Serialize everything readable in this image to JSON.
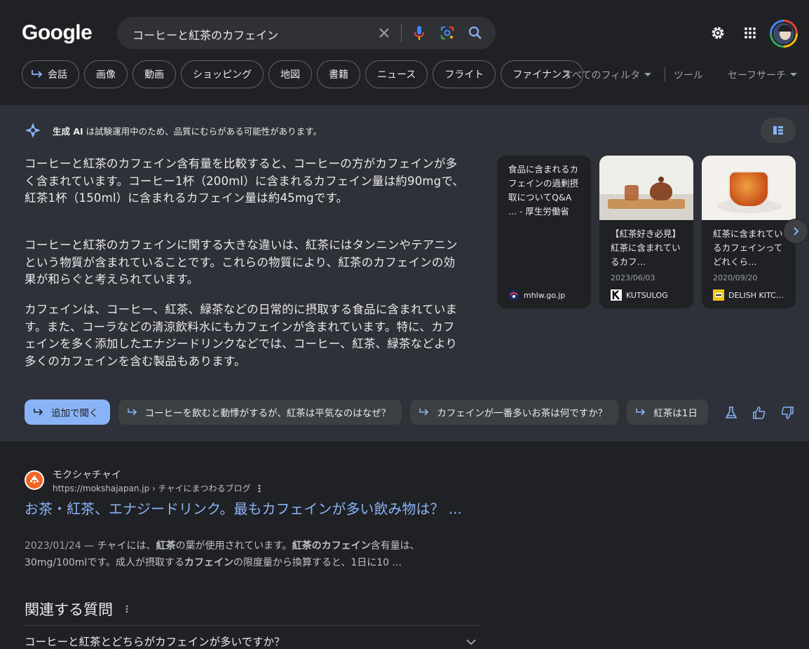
{
  "header": {
    "logo": "Google",
    "search_query": "コーヒーと紅茶のカフェイン",
    "icons": [
      "close-icon",
      "mic-icon",
      "lens-icon",
      "search-icon",
      "settings-icon",
      "apps-icon",
      "avatar"
    ]
  },
  "chips": [
    {
      "label": "会話",
      "icon": "reply-arrow-icon"
    },
    {
      "label": "画像"
    },
    {
      "label": "動画"
    },
    {
      "label": "ショッピング"
    },
    {
      "label": "地図"
    },
    {
      "label": "書籍"
    },
    {
      "label": "ニュース"
    },
    {
      "label": "フライト"
    },
    {
      "label": "ファイナンス"
    }
  ],
  "tools": {
    "all_filters": "すべてのフィルタ",
    "tools": "ツール",
    "safesearch": "セーフサーチ"
  },
  "ai_overview": {
    "note_bold": "生成 AI",
    "note_rest": " は試験運用中のため、品質にむらがある可能性があります。",
    "paragraphs": [
      "コーヒーと紅茶のカフェイン含有量を比較すると、コーヒーの方がカフェインが多く含まれています。コーヒー1杯（200ml）に含まれるカフェイン量は約90mgで、紅茶1杯（150ml）に含まれるカフェイン量は約45mgです。",
      "コーヒーと紅茶のカフェインに関する大きな違いは、紅茶にはタンニンやテアニンという物質が含まれていることです。これらの物質により、紅茶のカフェインの効果が和らぐと考えられています。",
      "カフェインは、コーヒー、紅茶、緑茶などの日常的に摂取する食品に含まれています。また、コーラなどの清涼飲料水にもカフェインが含まれています。特に、カフェインを多く添加したエナジードリンクなどでは、コーヒー、紅茶、緑茶などより多くのカフェインを含む製品もあります。"
    ],
    "cards": [
      {
        "title": "食品に含まれるカフェインの過剰摂取についてQ&A ... - 厚生労働省",
        "date": "",
        "source": "mhlw.go.jp"
      },
      {
        "title": "【紅茶好き必見】紅茶に含まれているカフ…",
        "date": "2023/06/03",
        "source": "KUTSULOG"
      },
      {
        "title": "紅茶に含まれているカフェインってどれくら…",
        "date": "2020/09/20",
        "source": "DELISH KITC…"
      }
    ],
    "followups": [
      "追加で聞く",
      "コーヒーを飲むと動悸がするが、紅茶は平気なのはなぜ？",
      "カフェインが一番多いお茶は何ですか？",
      "紅茶は1日"
    ]
  },
  "result": {
    "site_name": "モクシャチャイ",
    "url": "https://mokshajapan.jp › チャイにまつわるブログ",
    "title": "お茶・紅茶、エナジードリンク。最もカフェインが多い飲み物は？ ...",
    "date": "2023/01/24",
    "snippet_parts": [
      {
        "t": " — チャイには、",
        "b": false
      },
      {
        "t": "紅茶",
        "b": true
      },
      {
        "t": "の葉が使用されています。",
        "b": false
      },
      {
        "t": "紅茶のカフェイン",
        "b": true
      },
      {
        "t": "含有量は、30mg/100mlです。成人が摂取する",
        "b": false
      },
      {
        "t": "カフェイン",
        "b": true
      },
      {
        "t": "の限度量から換算すると、1日に10 ...",
        "b": false
      }
    ]
  },
  "related": {
    "title": "関連する質問",
    "questions": [
      "コーヒーと紅茶とどちらがカフェインが多いですか？"
    ]
  }
}
